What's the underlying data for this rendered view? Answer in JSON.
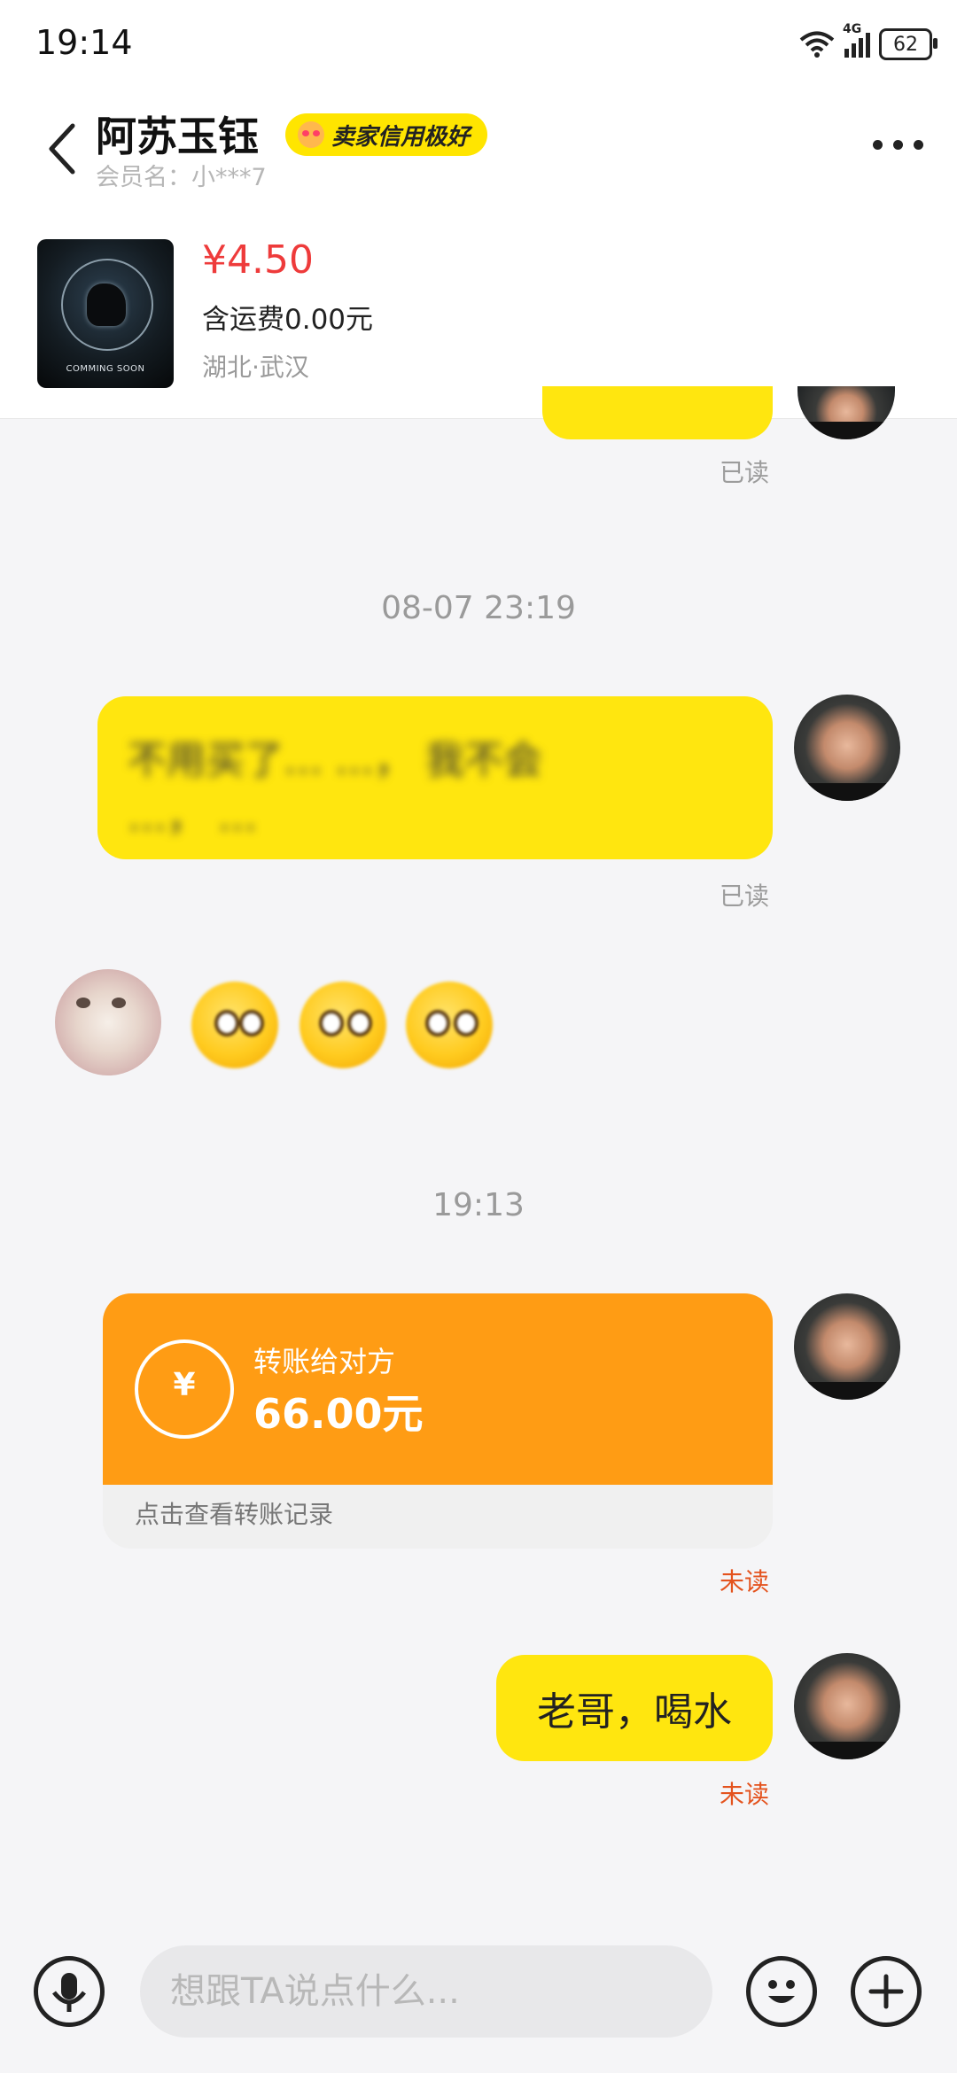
{
  "status_bar": {
    "time": "19:14",
    "network": "4G",
    "battery": "62"
  },
  "header": {
    "title": "阿苏玉钰",
    "badge": "卖家信用极好",
    "member": "会员名：小***7"
  },
  "product": {
    "price": "¥4.50",
    "shipping": "含运费0.00元",
    "location": "湖北·武汉",
    "thumb_text": "COMMING SOON"
  },
  "chat": {
    "msg1_status": "已读",
    "time1": "08-07 23:19",
    "msg2_line1": "不用买了…  …， 我不会",
    "msg2_line2": "…，  …",
    "msg2_status": "已读",
    "time2": "19:13",
    "transfer": {
      "icon_symbol": "¥",
      "title": "转账给对方",
      "amount": "66.00元",
      "footer": "点击查看转账记录",
      "status": "未读"
    },
    "msg_last": "老哥，喝水",
    "msg_last_status": "未读"
  },
  "input": {
    "placeholder": "想跟TA说点什么..."
  },
  "colors": {
    "accent_yellow": "#ffe60f",
    "transfer_orange": "#ff9c14",
    "price_red": "#ee3b3b",
    "unread_orange": "#e4531e"
  }
}
